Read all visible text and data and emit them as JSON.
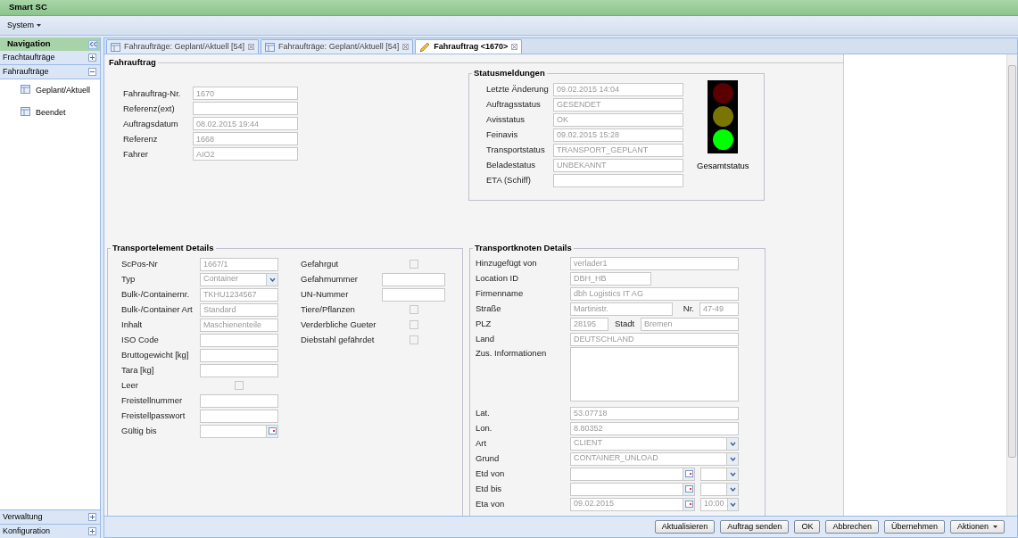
{
  "app_title": "Smart SC",
  "menu": [
    {
      "label": "System"
    }
  ],
  "sidebar": {
    "title": "Navigation",
    "sections": [
      {
        "label": "Frachtaufträge",
        "expanded": false
      },
      {
        "label": "Fahraufträge",
        "expanded": true,
        "children": [
          {
            "label": "Geplant/Aktuell"
          },
          {
            "label": "Beendet"
          }
        ]
      }
    ],
    "bottom_sections": [
      {
        "label": "Verwaltung",
        "expanded": false
      },
      {
        "label": "Konfiguration",
        "expanded": false
      }
    ]
  },
  "tabs": [
    {
      "label": "Fahraufträge: Geplant/Aktuell [54]",
      "selected": false,
      "kind": "list"
    },
    {
      "label": "Fahraufträge: Geplant/Aktuell [54]",
      "selected": false,
      "kind": "list"
    },
    {
      "label": "Fahrauftrag <1670>",
      "selected": true,
      "kind": "edit"
    }
  ],
  "fahrauftrag": {
    "title": "Fahrauftrag",
    "fields": [
      {
        "label": "Fahrauftrag-Nr.",
        "value": "1670"
      },
      {
        "label": "Referenz(ext)"
      },
      {
        "label": "Auftragsdatum",
        "value": "08.02.2015 19:44"
      },
      {
        "label": "Referenz",
        "value": "1668"
      },
      {
        "label": "Fahrer",
        "value": "AIO2"
      }
    ]
  },
  "status": {
    "title": "Statusmeldungen",
    "fields": [
      {
        "label": "Letzte Änderung",
        "value": "09.02.2015 14:04"
      },
      {
        "label": "Auftragsstatus",
        "value": "GESENDET"
      },
      {
        "label": "Avisstatus",
        "value": "OK"
      },
      {
        "label": "Feinavis",
        "value": "09.02.2015 15:28"
      },
      {
        "label": "Transportstatus",
        "value": "TRANSPORT_GEPLANT"
      },
      {
        "label": "Beladestatus",
        "value": "UNBEKANNT"
      },
      {
        "label": "ETA (Schiff)"
      }
    ],
    "lights": [
      {
        "kind": "red",
        "on": false
      },
      {
        "kind": "yellow",
        "on": false
      },
      {
        "kind": "green",
        "on": true
      }
    ],
    "caption": "Gesamtstatus"
  },
  "transportelement": {
    "title": "Transportelement Details",
    "left": [
      {
        "kind": "text",
        "label": "ScPos-Nr",
        "value": "1667/1"
      },
      {
        "kind": "select",
        "label": "Typ",
        "value": "Container"
      },
      {
        "kind": "text",
        "label": "Bulk-/Containernr.",
        "value": "TKHU1234567"
      },
      {
        "kind": "text",
        "label": "Bulk-/Container Art",
        "value": "Standard"
      },
      {
        "kind": "text",
        "label": "Inhalt",
        "value": "Maschienenteile"
      },
      {
        "kind": "text",
        "label": "ISO Code"
      },
      {
        "kind": "text",
        "label": "Bruttogewicht [kg]"
      },
      {
        "kind": "text",
        "label": "Tara [kg]"
      },
      {
        "kind": "checkbox",
        "label": "Leer",
        "checked": false
      },
      {
        "kind": "text",
        "label": "Freistellnummer"
      },
      {
        "kind": "text",
        "label": "Freistellpasswort"
      },
      {
        "kind": "date",
        "label": "Gültig bis"
      }
    ],
    "right": [
      {
        "kind": "checkbox",
        "label": "Gefahrgut",
        "checked": false
      },
      {
        "kind": "text",
        "label": "Gefahrnummer"
      },
      {
        "kind": "text",
        "label": "UN-Nummer"
      },
      {
        "kind": "checkbox",
        "label": "Tiere/Pflanzen",
        "checked": false
      },
      {
        "kind": "checkbox",
        "label": "Verderbliche Gueter",
        "checked": false
      },
      {
        "kind": "checkbox",
        "label": "Diebstahl gefährdet",
        "checked": false
      }
    ]
  },
  "transportknoten": {
    "title": "Transportknoten Details",
    "rows": [
      {
        "kind": "text",
        "label": "Hinzugefügt von",
        "value": "verlader1"
      },
      {
        "kind": "short",
        "label": "Location ID",
        "value": "DBH_HB"
      },
      {
        "kind": "text",
        "label": "Firmenname",
        "value": "dbh Logistics IT AG"
      },
      {
        "kind": "street",
        "label": "Straße",
        "value": "Martinistr.",
        "label2": "Nr.",
        "value2": "47-49"
      },
      {
        "kind": "zip",
        "label": "PLZ",
        "value": "28195",
        "label2": "Stadt",
        "value2": "Bremen"
      },
      {
        "kind": "text",
        "label": "Land",
        "value": "DEUTSCHLAND"
      },
      {
        "kind": "textarea",
        "label": "Zus. Informationen"
      },
      {
        "kind": "text",
        "label": "Lat.",
        "value": "53.07718"
      },
      {
        "kind": "text",
        "label": "Lon.",
        "value": "8.80352"
      },
      {
        "kind": "select",
        "label": "Art",
        "value": "CLIENT"
      },
      {
        "kind": "select",
        "label": "Grund",
        "value": "CONTAINER_UNLOAD"
      },
      {
        "kind": "datetime",
        "label": "Etd von"
      },
      {
        "kind": "datetime",
        "label": "Etd bis"
      },
      {
        "kind": "datetime",
        "label": "Eta von",
        "value": "09.02.2015",
        "value2": "10:00"
      }
    ]
  },
  "buttons": [
    {
      "label": "Aktualisieren",
      "kind": "plain"
    },
    {
      "label": "Auftrag senden",
      "kind": "plain"
    },
    {
      "label": "OK",
      "kind": "plain"
    },
    {
      "label": "Abbrechen",
      "kind": "plain"
    },
    {
      "label": "Übernehmen",
      "kind": "plain"
    },
    {
      "label": "Aktionen",
      "kind": "menu"
    }
  ]
}
